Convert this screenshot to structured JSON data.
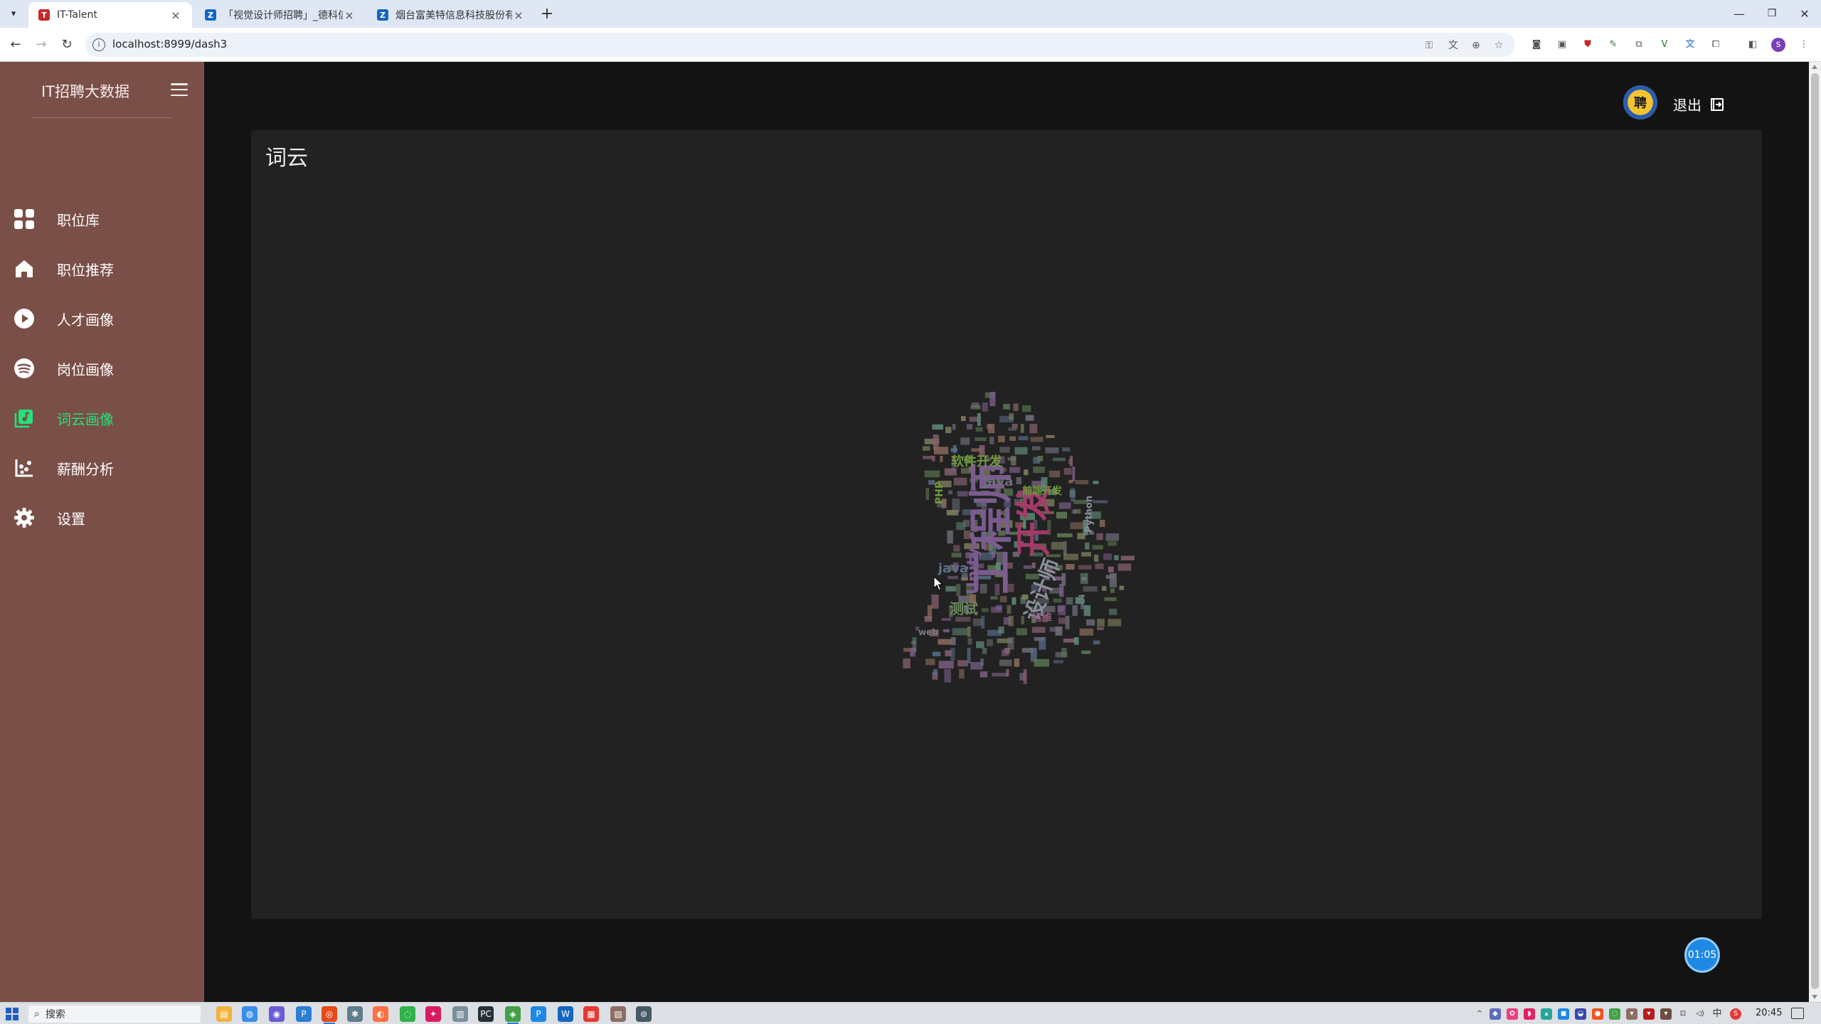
{
  "browser": {
    "tabs": [
      {
        "title": "IT-Talent",
        "favicon": "it-talent-favicon",
        "active": true
      },
      {
        "title": "「视觉设计师招聘」_德科信息…",
        "favicon": "job-site-favicon",
        "active": false
      },
      {
        "title": "烟台富美特信息科技股份有限公…",
        "favicon": "job-site-favicon",
        "active": false
      }
    ],
    "url": "localhost:8999/dash3",
    "profile_initial": "s"
  },
  "sidebar": {
    "brand": "IT招聘大数据",
    "items": [
      {
        "label": "职位库",
        "icon": "grid-icon",
        "active": false
      },
      {
        "label": "职位推荐",
        "icon": "home-icon",
        "active": false
      },
      {
        "label": "人才画像",
        "icon": "play-circle-icon",
        "active": false
      },
      {
        "label": "岗位画像",
        "icon": "spotify-icon",
        "active": false
      },
      {
        "label": "词云画像",
        "icon": "music-library-icon",
        "active": true
      },
      {
        "label": "薪酬分析",
        "icon": "scatter-chart-icon",
        "active": false
      },
      {
        "label": "设置",
        "icon": "gear-icon",
        "active": false
      }
    ]
  },
  "header": {
    "avatar_text": "聘",
    "logout_label": "退出"
  },
  "card": {
    "title": "词云"
  },
  "wordcloud": {
    "words": [
      {
        "text": "工程师",
        "color": "#7b5c8e"
      },
      {
        "text": "开发",
        "color": "#a33a6a"
      },
      {
        "text": "设计师",
        "color": "#8a8f9c"
      },
      {
        "text": "软件开发",
        "color": "#6f9a3a"
      },
      {
        "text": "Java",
        "color": "#6f6f7c"
      },
      {
        "text": "前端开发",
        "color": "#6f9a3a"
      },
      {
        "text": "PHP",
        "color": "#6f9a3a"
      },
      {
        "text": "Unity",
        "color": "#7b5c8e"
      },
      {
        "text": "java",
        "color": "#5c6f8e"
      },
      {
        "text": "Python",
        "color": "#8a8f9c"
      },
      {
        "text": "测试",
        "color": "#6a8a5a"
      },
      {
        "text": "运维",
        "color": "#8e5c7b"
      },
      {
        "text": "web",
        "color": "#7a7a7a"
      },
      {
        "text": "UI",
        "color": "#5a8a6a"
      }
    ]
  },
  "timer": {
    "text": "01:05",
    "color": "#1e88e5"
  },
  "taskbar": {
    "search_label": "搜索",
    "time": "20:45",
    "ime": "中"
  },
  "colors": {
    "sidebar_bg": "#7a4f47",
    "active_nav": "#22e37a",
    "card_bg": "#222222",
    "page_bg": "#131313"
  }
}
